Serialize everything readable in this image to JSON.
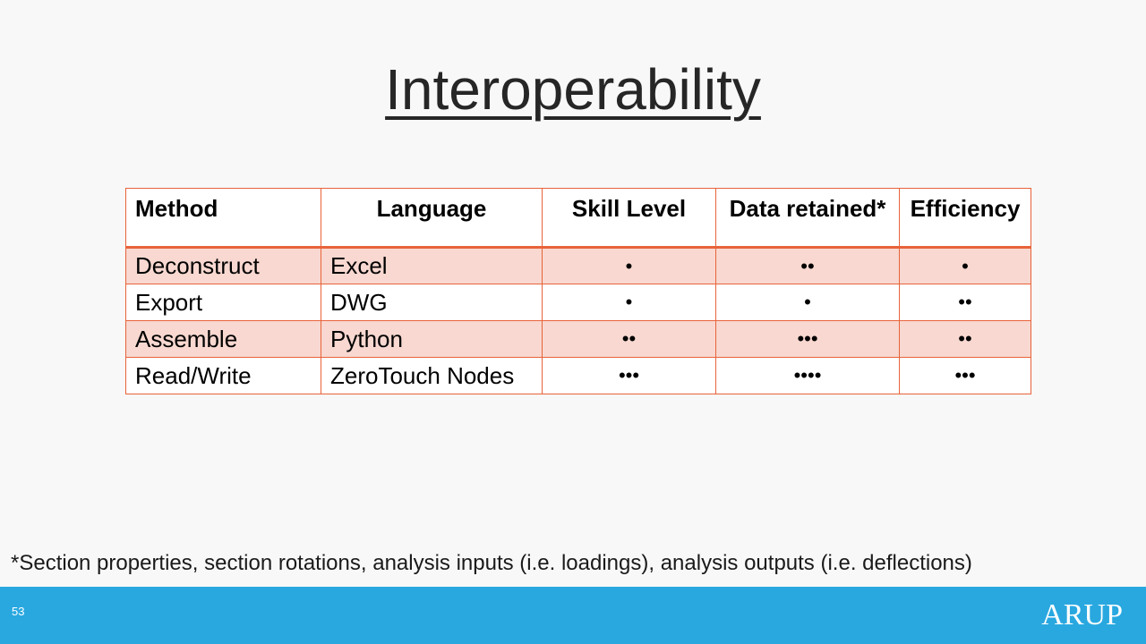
{
  "slide": {
    "title": "Interoperability",
    "footnote": "*Section properties, section rotations, analysis inputs (i.e. loadings), analysis outputs (i.e. deflections)",
    "page_number": "53",
    "logo_text": "ARUP"
  },
  "table": {
    "headers": [
      "Method",
      "Language",
      "Skill Level",
      "Data retained*",
      "Efficiency"
    ],
    "rows": [
      [
        "Deconstruct",
        "Excel",
        "•",
        "••",
        "•"
      ],
      [
        "Export",
        "DWG",
        "•",
        "•",
        "••"
      ],
      [
        "Assemble",
        "Python",
        "••",
        "•••",
        "••"
      ],
      [
        "Read/Write",
        "ZeroTouch Nodes",
        "•••",
        "••••",
        "•••"
      ]
    ]
  },
  "colors": {
    "accent_border": "#e8633a",
    "row_band": "#f8d8d0",
    "footer_bar": "#29a8e0",
    "background": "#f8f8f8"
  }
}
